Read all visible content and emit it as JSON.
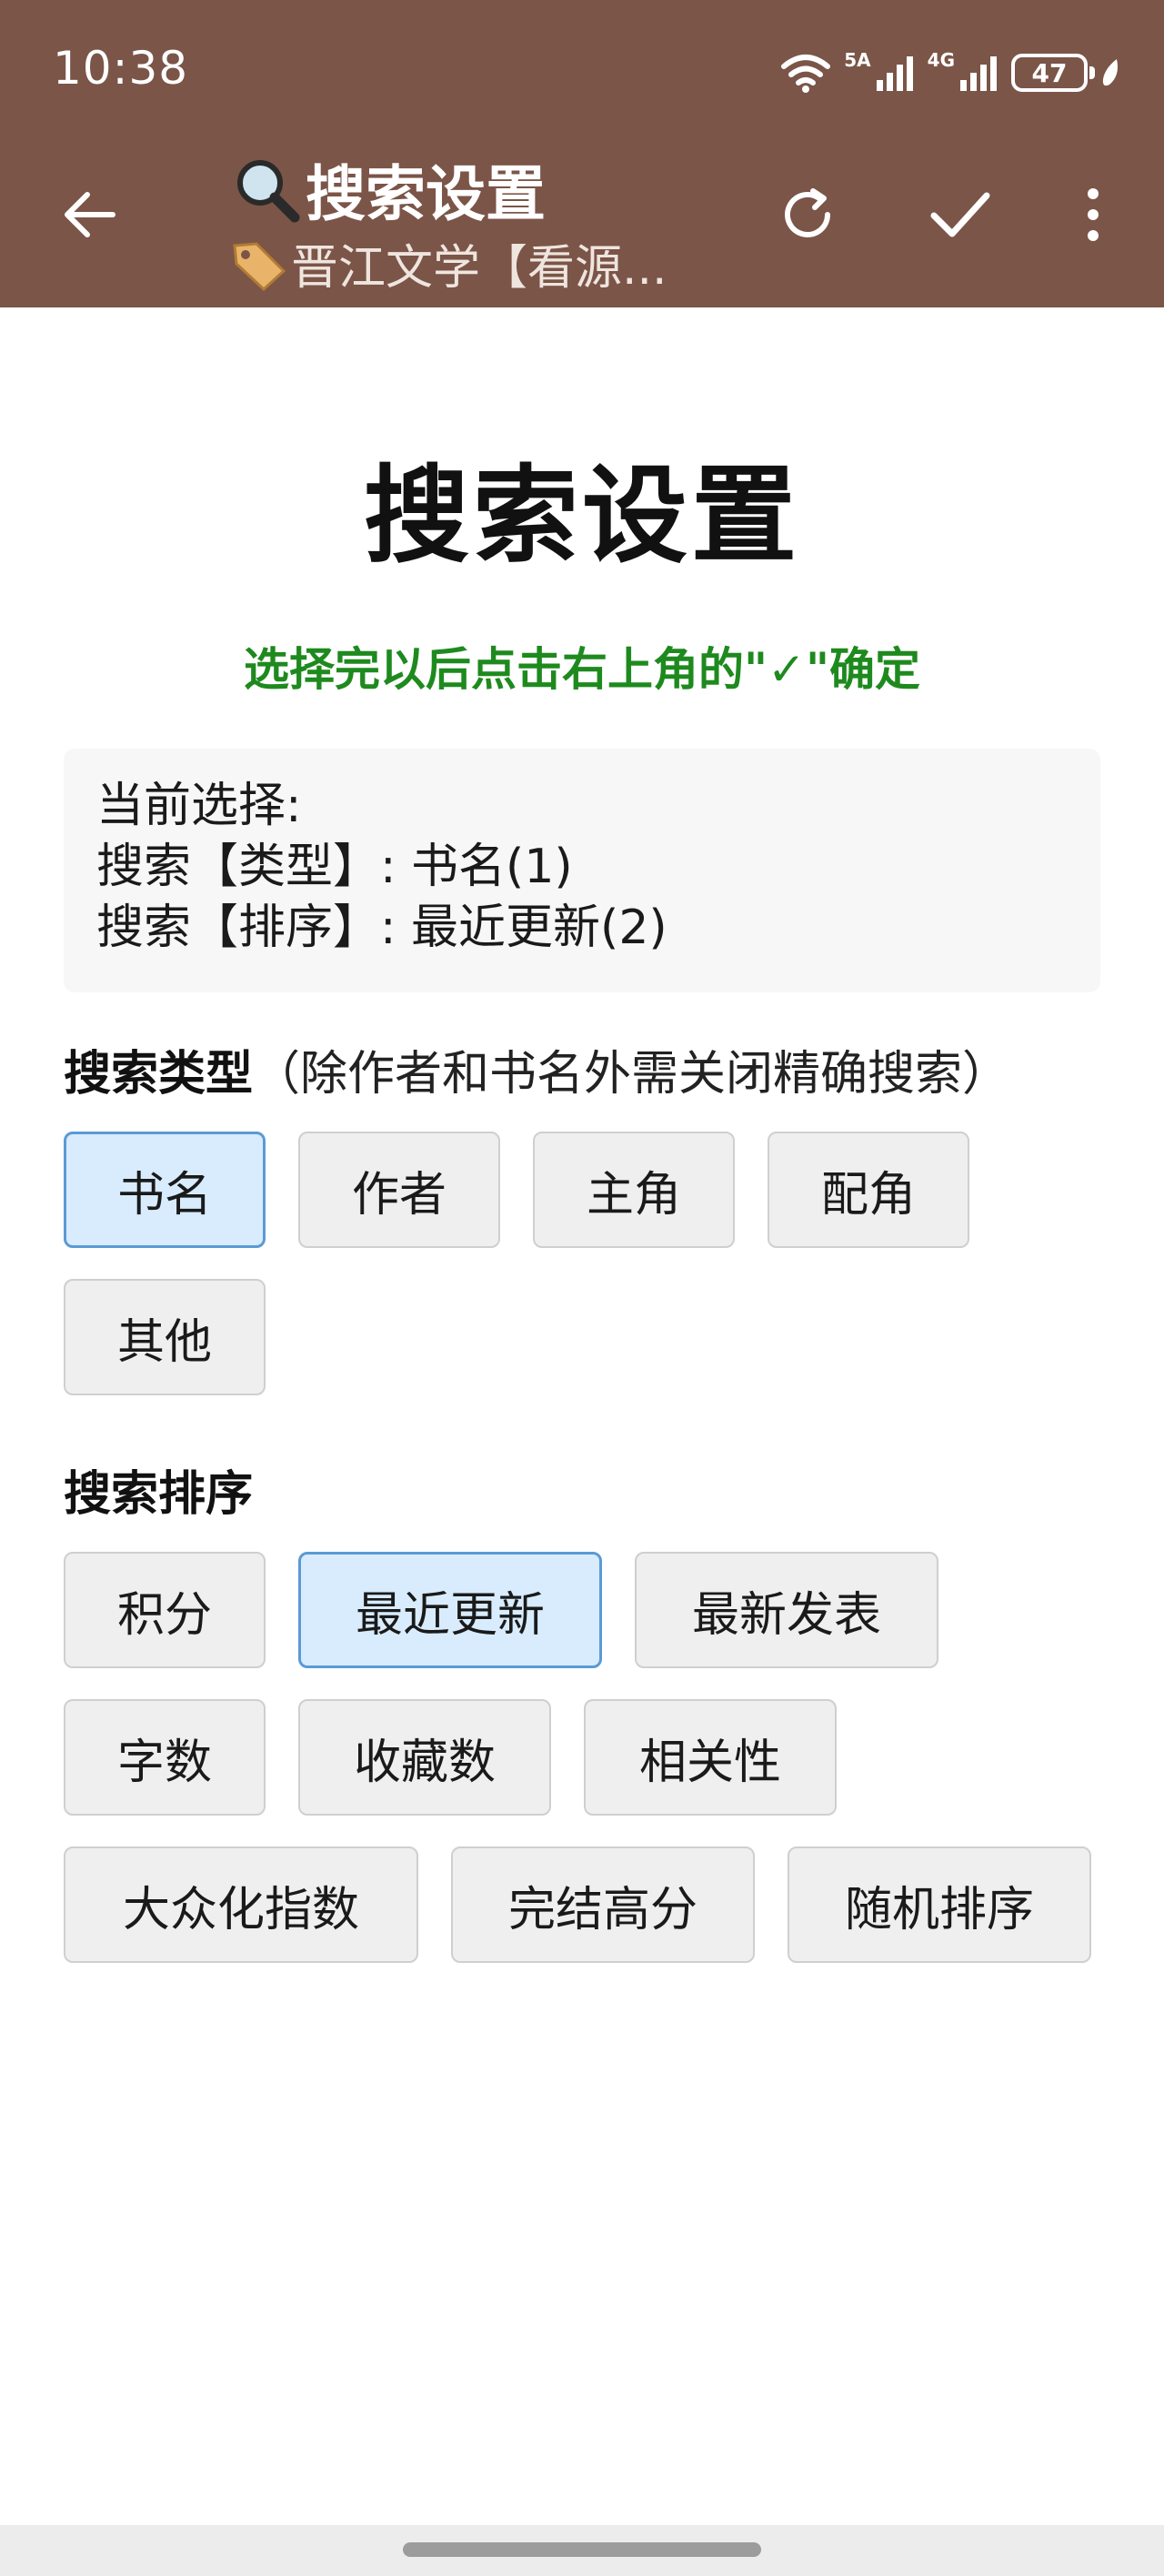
{
  "status_bar": {
    "time": "10:38",
    "net_5g_label": "5A",
    "net_4g_label": "4G",
    "battery": "47"
  },
  "toolbar": {
    "title_icon": "magnifier-icon",
    "title": "搜索设置",
    "subtitle_icon": "tag-icon",
    "subtitle": "晋江文学【看源..."
  },
  "page": {
    "heading": "搜索设置",
    "hint": "选择完以后点击右上角的\"✓\"确定",
    "current": {
      "label": "当前选择:",
      "type_line": "搜索【类型】: 书名(1)",
      "sort_line": "搜索【排序】: 最近更新(2)"
    }
  },
  "search_type": {
    "title": "搜索类型",
    "note": "（除作者和书名外需关闭精确搜索）",
    "options": [
      "书名",
      "作者",
      "主角",
      "配角",
      "其他"
    ],
    "selected": "书名"
  },
  "search_sort": {
    "title": "搜索排序",
    "options": [
      "积分",
      "最近更新",
      "最新发表",
      "字数",
      "收藏数",
      "相关性",
      "大众化指数",
      "完结高分",
      "随机排序"
    ],
    "selected": "最近更新"
  },
  "colors": {
    "appbar": "#7b5548",
    "hint_green": "#1e8a1e",
    "chip_bg": "#efefef",
    "chip_selected_bg": "#d8ecfd",
    "chip_selected_border": "#5b9ad6"
  }
}
